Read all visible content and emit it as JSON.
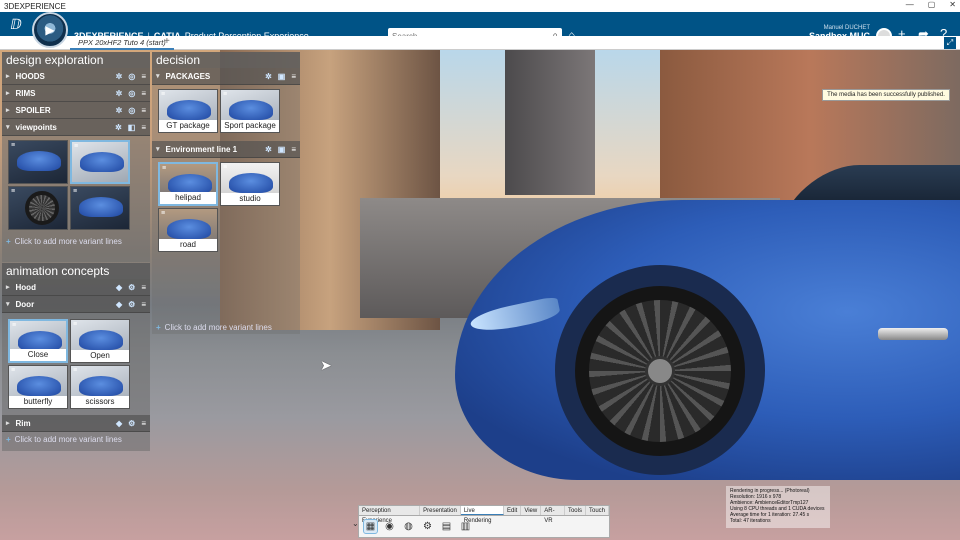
{
  "window": {
    "title": "3DEXPERIENCE",
    "controls": [
      "—",
      "▢",
      "✕"
    ]
  },
  "header": {
    "brand": "3DEXPERIENCE",
    "separator": "|",
    "product": "CATIA",
    "app": "Product Perception Experience",
    "search_placeholder": "Search",
    "user": "Manuel DUCHET",
    "workspace": "Sandbox MUC ⌄"
  },
  "tabs": {
    "active": "PPX 20xHF2 Tuto 4 (start)",
    "add": "+"
  },
  "design_exploration": {
    "title": "design exploration",
    "rows": [
      {
        "label": "HOODS"
      },
      {
        "label": "RIMS"
      },
      {
        "label": "SPOILER"
      },
      {
        "label": "viewpoints"
      }
    ],
    "add_line": "Click to add more variant lines"
  },
  "animation_concepts": {
    "title": "animation concepts",
    "rows": [
      {
        "label": "Hood"
      },
      {
        "label": "Door"
      },
      {
        "label": "Rim"
      }
    ],
    "door_items": [
      {
        "label": "Close"
      },
      {
        "label": "Open"
      },
      {
        "label": "butterfly"
      },
      {
        "label": "scissors"
      }
    ],
    "add_line": "Click to add more variant lines"
  },
  "decision": {
    "title": "decision",
    "packages_row": "PACKAGES",
    "packages": [
      {
        "label": "GT package"
      },
      {
        "label": "Sport package"
      }
    ],
    "environment_row": "Environment line 1",
    "environments": [
      {
        "label": "helipad"
      },
      {
        "label": "studio"
      },
      {
        "label": "road"
      }
    ],
    "add_line": "Click to add more variant lines"
  },
  "notification": "The media has been successfully published.",
  "render_info": {
    "line1": "Rendering in progress... (Photoreal)",
    "line2": "Resolution: 1916 x 978",
    "line3": "Ambience: AmbienceEditorTmp127",
    "line4": "Using 8 CPU threads and 1 CUDA devices",
    "line5": "Average time for 1 iteration: 27.45 s",
    "line6": "Total: 47 iterations"
  },
  "action_bar": {
    "tabs": [
      "Perception Experience",
      "Presentation",
      "Live Rendering",
      "Edit",
      "View",
      "AR-VR",
      "Tools",
      "Touch"
    ],
    "active_tab": "Live Rendering"
  },
  "colors": {
    "header_bg": "#005386",
    "accent": "#7fb8e0"
  }
}
